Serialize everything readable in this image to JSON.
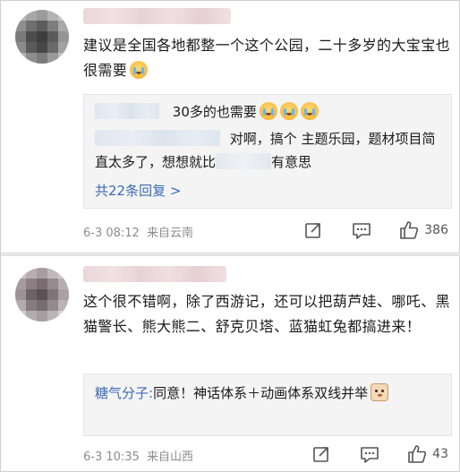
{
  "comments": [
    {
      "text": "建议是全国各地都整一个这个公园，二十多岁的大宝宝也很需要",
      "replies": [
        {
          "text": "30多的也需要"
        },
        {
          "text_a": "对啊，搞个 主题乐园，题材项目简直太多了，想想就比",
          "text_b": "有意思"
        }
      ],
      "more_replies": "共22条回复 >",
      "date": "6-3 08:12",
      "source": "来自云南",
      "likes": "386"
    },
    {
      "text": "这个很不错啊，除了西游记，还可以把葫芦娃、哪吒、黑猫警长、熊大熊二、舒克贝塔、蓝猫虹兔都搞进来！",
      "replies": [
        {
          "name": "糖气分子:",
          "text": "同意！神话体系＋动画体系双线并举"
        }
      ],
      "date": "6-3 10:35",
      "source": "来自山西",
      "likes": "43"
    }
  ],
  "icons": {
    "repost": "repost-icon",
    "comment": "comment-icon",
    "like": "thumbs-up-icon"
  },
  "colors": {
    "link": "#3b6bb5",
    "meta": "#8c8c8c",
    "reply_bg": "#f4f4f4"
  }
}
